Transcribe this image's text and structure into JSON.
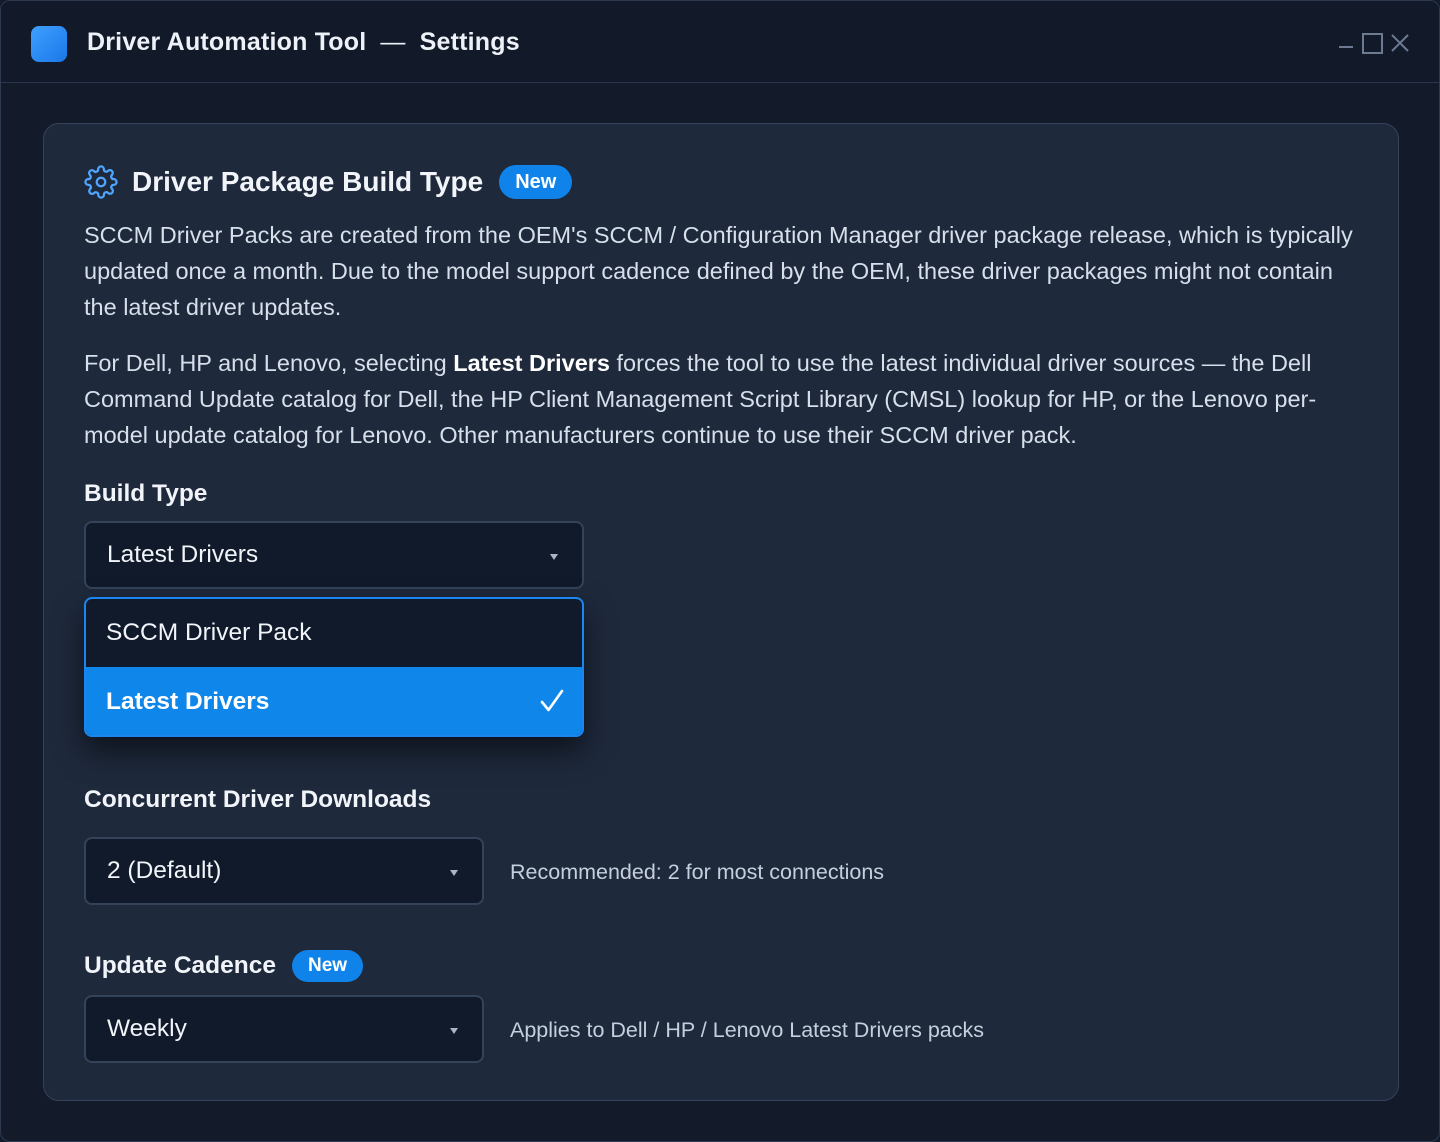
{
  "window": {
    "app_name": "Driver Automation Tool",
    "separator": "—",
    "page_name": "Settings",
    "accent_color": "#1083ea"
  },
  "section": {
    "icon": "gear-icon",
    "title": "Driver Package Build Type",
    "badge": "New",
    "paragraph1": "SCCM Driver Packs are created from the OEM's SCCM / Configuration Manager driver package release, which is typically updated once a month. Due to the model support cadence defined by the OEM, these driver packages might not contain the latest driver updates.",
    "paragraph2_before": "For Dell, HP and Lenovo, selecting ",
    "paragraph2_bold": "Latest Drivers",
    "paragraph2_after": " forces the tool to use the latest individual driver sources — the Dell Command Update catalog for Dell, the HP Client Management Script Library (CMSL) lookup for HP, or the Lenovo per-model update catalog for Lenovo. Other manufacturers continue to use their SCCM driver pack."
  },
  "build_type": {
    "label": "Build Type",
    "selected": "Latest Drivers",
    "options": [
      "SCCM Driver Pack",
      "Latest Drivers"
    ],
    "selected_index": 1,
    "check_icon": "check-icon"
  },
  "concurrent": {
    "label": "Concurrent Driver Downloads",
    "selected": "2 (Default)",
    "hint": "Recommended: 2 for most connections"
  },
  "cadence": {
    "label": "Update Cadence",
    "badge": "New",
    "selected": "Weekly",
    "hint": "Applies to Dell / HP / Lenovo Latest Drivers packs"
  }
}
